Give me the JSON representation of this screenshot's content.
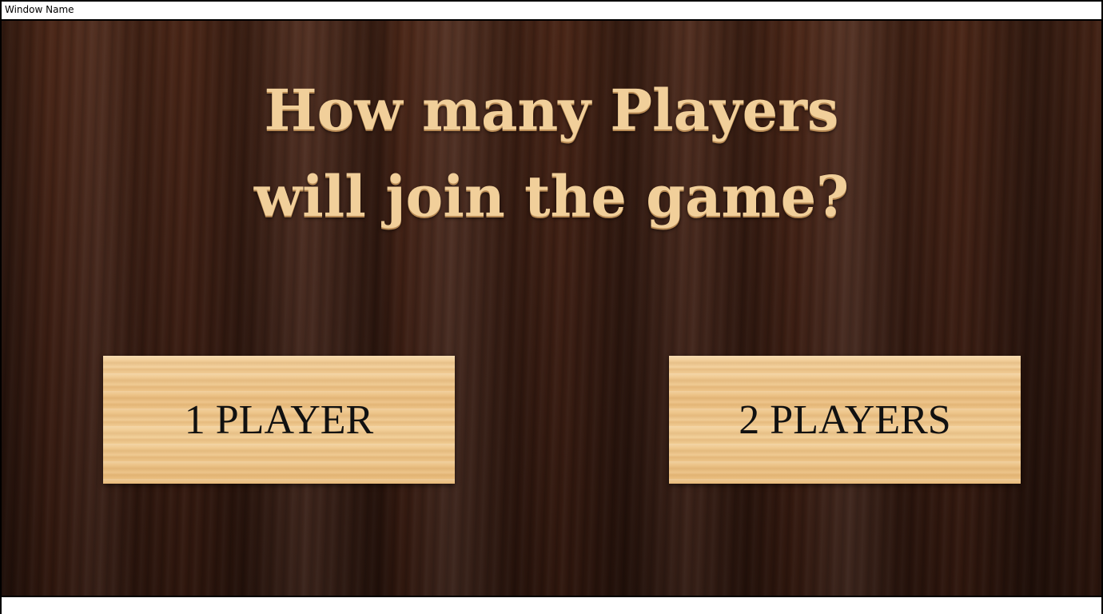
{
  "window": {
    "title": "Window Name"
  },
  "screen": {
    "heading_line1": "How many Players",
    "heading_line2": "will join the game?"
  },
  "buttons": {
    "one_player": "1 PLAYER",
    "two_players": "2 PLAYERS"
  },
  "colors": {
    "heading_text": "#f1cf9a",
    "button_text": "#111111",
    "background_wood": "#3a1d12",
    "button_wood": "#efc88e"
  }
}
